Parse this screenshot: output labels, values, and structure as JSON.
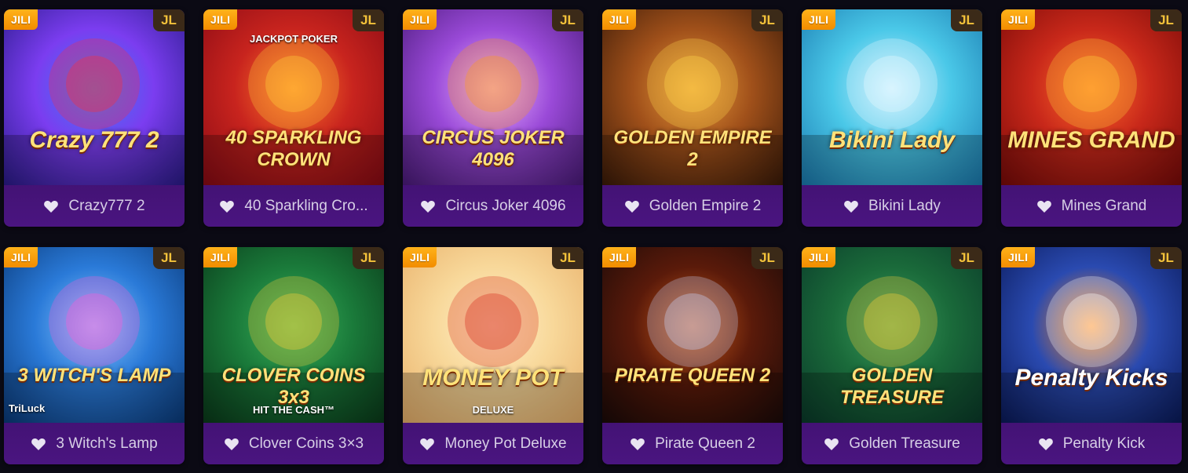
{
  "provider_badge": "JILI",
  "studio_badge": "JL",
  "games": [
    {
      "name": "Crazy777 2",
      "title": "Crazy 777 2",
      "bg": [
        "#2a1b8a",
        "#7b3df0",
        "#3a7cf5"
      ],
      "accent": "#ff2a3a"
    },
    {
      "name": "40 Sparkling Cro...",
      "title": "40 SPARKLING CROWN",
      "bg": [
        "#8a0a14",
        "#c8241e",
        "#ff7a2a"
      ],
      "accent": "#ffd23a",
      "extra": "JACKPOT POKER"
    },
    {
      "name": "Circus Joker 4096",
      "title": "CIRCUS JOKER 4096",
      "bg": [
        "#4a1a7a",
        "#9a4ad8",
        "#e8b0ff"
      ],
      "accent": "#ff9a1a"
    },
    {
      "name": "Golden Empire 2",
      "title": "GOLDEN EMPIRE 2",
      "bg": [
        "#3a1a08",
        "#a0501a",
        "#e89a3a"
      ],
      "accent": "#ffd84a"
    },
    {
      "name": "Bikini Lady",
      "title": "Bikini Lady",
      "bg": [
        "#1a7ab0",
        "#4ac8e8",
        "#c8f0ff"
      ],
      "accent": "#e8f8ff"
    },
    {
      "name": "Mines Grand",
      "title": "MINES GRAND",
      "bg": [
        "#7a0a08",
        "#c8281a",
        "#ff6a2a"
      ],
      "accent": "#ffd23a"
    },
    {
      "name": "3 Witch's Lamp",
      "title": "3 WITCH'S LAMP",
      "bg": [
        "#0a3a7a",
        "#2a7ad8",
        "#8ac8ff"
      ],
      "accent": "#ff5ad8",
      "extra": "TriLuck"
    },
    {
      "name": "Clover Coins 3×3",
      "title": "CLOVER COINS 3x3",
      "bg": [
        "#0a3a1a",
        "#1a7a3a",
        "#3ab05a"
      ],
      "accent": "#ffd23a",
      "extra": "HIT THE CASH™"
    },
    {
      "name": "Money Pot Deluxe",
      "title": "MONEY POT",
      "bg": [
        "#e8b06a",
        "#f8d89a",
        "#fff0c8"
      ],
      "accent": "#d8281a",
      "extra": "DELUXE"
    },
    {
      "name": "Pirate Queen 2",
      "title": "PIRATE QUEEN 2",
      "bg": [
        "#1a0a08",
        "#5a1a0a",
        "#c85a1a"
      ],
      "accent": "#c8d8ff"
    },
    {
      "name": "Golden Treasure",
      "title": "GOLDEN TREASURE",
      "bg": [
        "#0a3a2a",
        "#1a6a3a",
        "#3a9a5a"
      ],
      "accent": "#ffd23a"
    },
    {
      "name": "Penalty Kick",
      "title": "Penalty Kicks",
      "bg": [
        "#0a1a5a",
        "#2a4ab0",
        "#ff8a1a"
      ],
      "accent": "#ffffff"
    }
  ]
}
